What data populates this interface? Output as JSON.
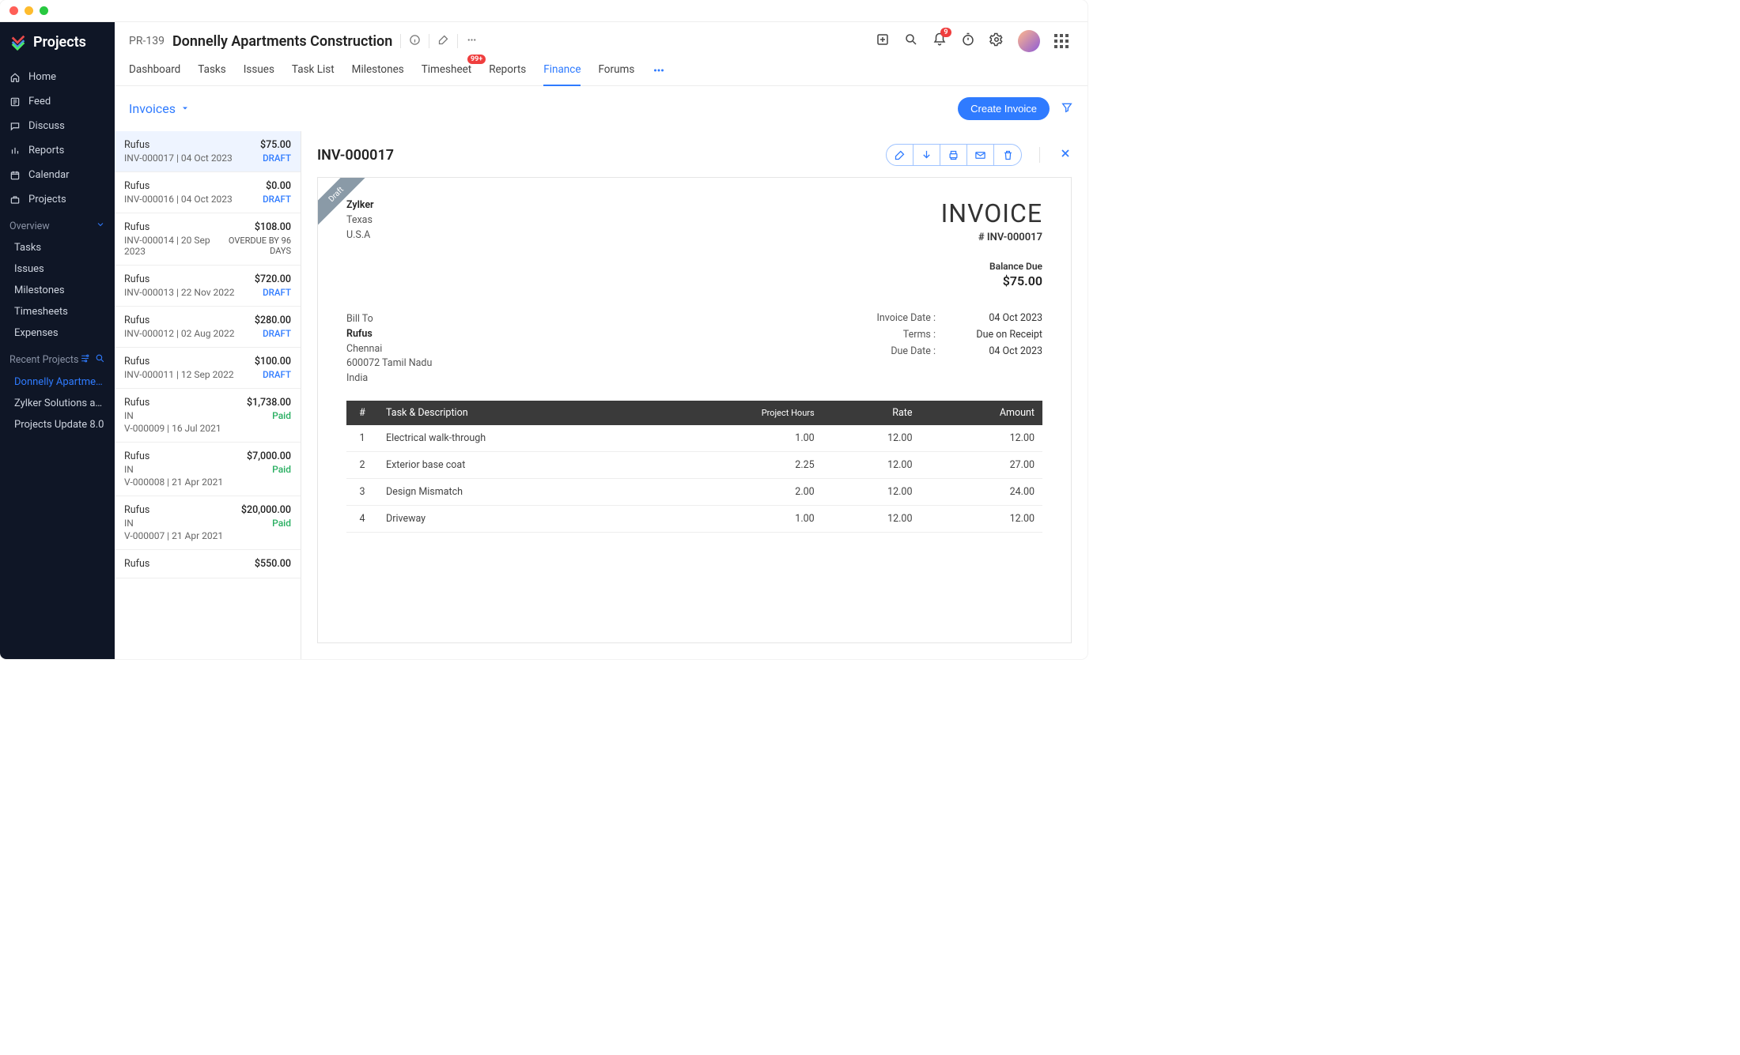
{
  "app": {
    "name": "Projects"
  },
  "sidebar": {
    "items": [
      {
        "label": "Home",
        "icon": "home-icon"
      },
      {
        "label": "Feed",
        "icon": "feed-icon"
      },
      {
        "label": "Discuss",
        "icon": "discuss-icon"
      },
      {
        "label": "Reports",
        "icon": "reports-icon"
      },
      {
        "label": "Calendar",
        "icon": "calendar-icon"
      },
      {
        "label": "Projects",
        "icon": "briefcase-icon"
      }
    ],
    "overview_label": "Overview",
    "overview_items": [
      "Tasks",
      "Issues",
      "Milestones",
      "Timesheets",
      "Expenses"
    ],
    "recent_label": "Recent Projects",
    "recent_items": [
      "Donnelly Apartments Const",
      "Zylker Solutions and Constr",
      "Projects Update 8.0"
    ]
  },
  "project": {
    "code": "PR-139",
    "name": "Donnelly Apartments Construction"
  },
  "header": {
    "bell_badge": "9"
  },
  "tabs": {
    "items": [
      "Dashboard",
      "Tasks",
      "Issues",
      "Task List",
      "Milestones",
      "Timesheet",
      "Reports",
      "Finance",
      "Forums"
    ],
    "timesheet_badge": "99+",
    "active": "Finance"
  },
  "subbar": {
    "section": "Invoices",
    "create_button": "Create Invoice"
  },
  "invoice_list": [
    {
      "client": "Rufus",
      "amount": "$75.00",
      "num": "INV-000017",
      "date": "04 Oct 2023",
      "status": "DRAFT",
      "statusType": "draft"
    },
    {
      "client": "Rufus",
      "amount": "$0.00",
      "num": "INV-000016",
      "date": "04 Oct 2023",
      "status": "DRAFT",
      "statusType": "draft"
    },
    {
      "client": "Rufus",
      "amount": "$108.00",
      "num": "INV-000014",
      "date": "20 Sep 2023",
      "status": "OVERDUE BY 96 DAYS",
      "statusType": "overdue"
    },
    {
      "client": "Rufus",
      "amount": "$720.00",
      "num": "INV-000013",
      "date": "22 Nov 2022",
      "status": "DRAFT",
      "statusType": "draft"
    },
    {
      "client": "Rufus",
      "amount": "$280.00",
      "num": "INV-000012",
      "date": "02 Aug 2022",
      "status": "DRAFT",
      "statusType": "draft"
    },
    {
      "client": "Rufus",
      "amount": "$100.00",
      "num": "INV-000011",
      "date": "12 Sep 2022",
      "status": "DRAFT",
      "statusType": "draft"
    },
    {
      "client": "Rufus",
      "amount": "$1,738.00",
      "line2": "IN",
      "num": "V-000009",
      "date": "16 Jul 2021",
      "status": "Paid",
      "statusType": "paid"
    },
    {
      "client": "Rufus",
      "amount": "$7,000.00",
      "line2": "IN",
      "num": "V-000008",
      "date": "21 Apr 2021",
      "status": "Paid",
      "statusType": "paid"
    },
    {
      "client": "Rufus",
      "amount": "$20,000.00",
      "line2": "IN",
      "num": "V-000007",
      "date": "21 Apr 2021",
      "status": "Paid",
      "statusType": "paid"
    },
    {
      "client": "Rufus",
      "amount": "$550.00"
    }
  ],
  "detail": {
    "title": "INV-000017"
  },
  "invoice_doc": {
    "ribbon": "Draft",
    "from": {
      "company": "Zylker",
      "line1": "Texas",
      "line2": "U.S.A"
    },
    "doc_title": "INVOICE",
    "doc_number": "# INV-000017",
    "balance_label": "Balance Due",
    "balance_amount": "$75.00",
    "billto_label": "Bill To",
    "billto": {
      "name": "Rufus",
      "line1": "Chennai",
      "line2": "600072 Tamil Nadu",
      "line3": "India"
    },
    "meta": [
      {
        "label": "Invoice Date :",
        "value": "04 Oct 2023"
      },
      {
        "label": "Terms :",
        "value": "Due on Receipt"
      },
      {
        "label": "Due Date :",
        "value": "04 Oct 2023"
      }
    ],
    "columns": {
      "num": "#",
      "task": "Task & Description",
      "hours": "Project Hours",
      "rate": "Rate",
      "amount": "Amount"
    },
    "items": [
      {
        "n": "1",
        "task": "Electrical walk-through",
        "hours": "1.00",
        "rate": "12.00",
        "amount": "12.00"
      },
      {
        "n": "2",
        "task": "Exterior base coat",
        "hours": "2.25",
        "rate": "12.00",
        "amount": "27.00"
      },
      {
        "n": "3",
        "task": "Design Mismatch",
        "hours": "2.00",
        "rate": "12.00",
        "amount": "24.00"
      },
      {
        "n": "4",
        "task": "Driveway",
        "hours": "1.00",
        "rate": "12.00",
        "amount": "12.00"
      }
    ]
  }
}
